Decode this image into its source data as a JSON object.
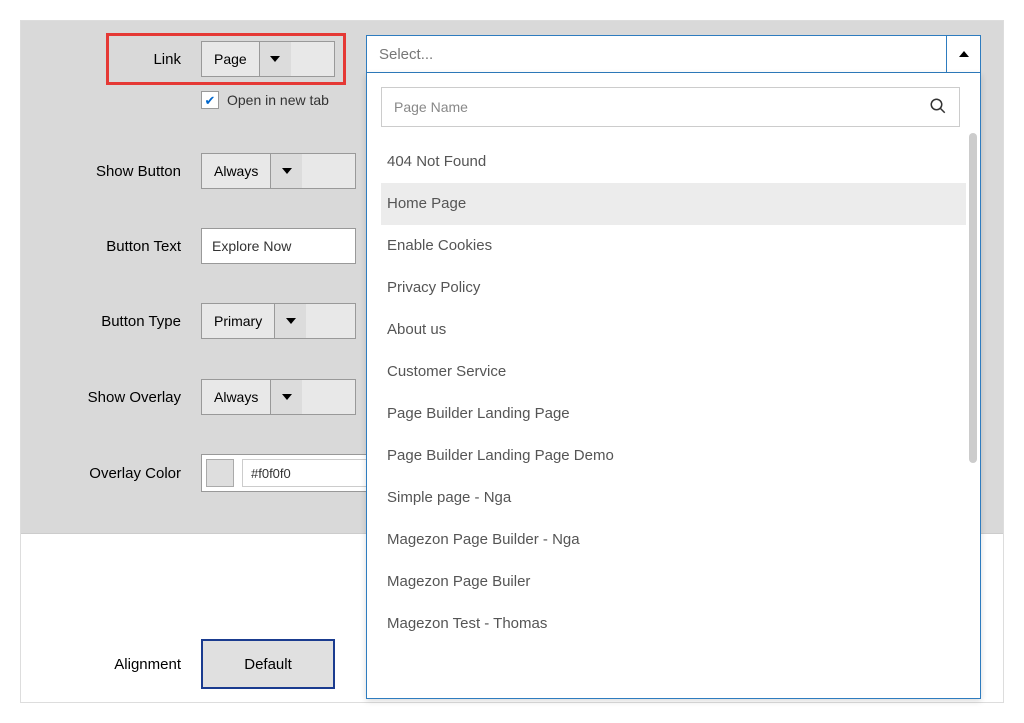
{
  "labels": {
    "link": "Link",
    "show_button": "Show Button",
    "button_text": "Button Text",
    "button_type": "Button Type",
    "show_overlay": "Show Overlay",
    "overlay_color": "Overlay Color",
    "alignment": "Alignment"
  },
  "fields": {
    "link_type": "Page",
    "open_new_tab_label": "Open in new tab",
    "show_button": "Always",
    "button_text": "Explore Now",
    "button_type": "Primary",
    "show_overlay": "Always",
    "overlay_color_hex": "#f0f0f0",
    "alignment": "Default"
  },
  "dropdown": {
    "placeholder": "Select...",
    "search_placeholder": "Page Name",
    "items": [
      "404 Not Found",
      "Home Page",
      "Enable Cookies",
      "Privacy Policy",
      "About us",
      "Customer Service",
      "Page Builder Landing Page",
      "Page Builder Landing Page Demo",
      "Simple page - Nga",
      "Magezon Page Builder - Nga",
      "Magezon Page Builer",
      "Magezon Test - Thomas"
    ],
    "hovered_index": 1
  },
  "colors": {
    "overlay_swatch": "#dedede"
  }
}
